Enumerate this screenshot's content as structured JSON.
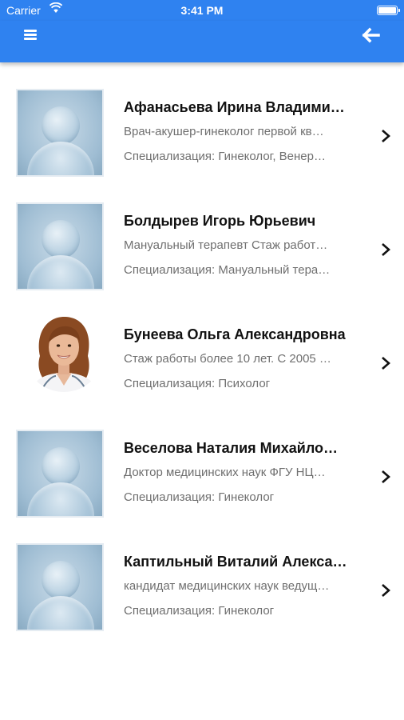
{
  "status_bar": {
    "carrier": "Carrier",
    "time": "3:41 PM",
    "icons": [
      "wifi-icon",
      "battery-icon"
    ]
  },
  "nav": {
    "left_icon": "menu-icon",
    "right_icon": "back-arrow-icon",
    "color": "#2f82f0"
  },
  "doctors": [
    {
      "name": "Афанасьева Ирина Владими…",
      "description": "Врач-акушер-гинеколог первой кв…",
      "specialization": "Специализация: Гинеколог, Венер…",
      "avatar": "placeholder"
    },
    {
      "name": "Болдырев Игорь Юрьевич",
      "description": "Мануальный терапевт Стаж работ…",
      "specialization": "Специализация: Мануальный тера…",
      "avatar": "placeholder"
    },
    {
      "name": "Бунеева Ольга Александровна",
      "description": "Стаж работы более 10 лет. С 2005 …",
      "specialization": "Специализация: Психолог",
      "avatar": "photo"
    },
    {
      "name": "Веселова Наталия Михайло…",
      "description": "Доктор медицинских наук ФГУ НЦ…",
      "specialization": "Специализация: Гинеколог",
      "avatar": "placeholder"
    },
    {
      "name": "Каптильный Виталий Алекса…",
      "description": "кандидат медицинских наук ведущ…",
      "specialization": "Специализация: Гинеколог",
      "avatar": "placeholder"
    }
  ]
}
